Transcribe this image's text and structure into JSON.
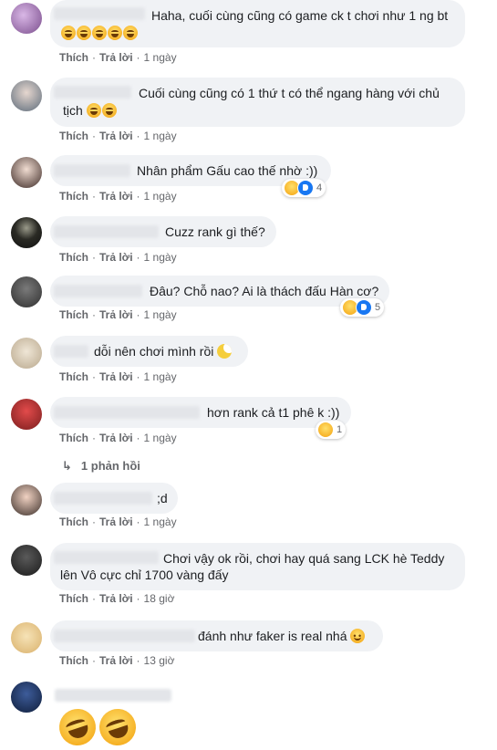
{
  "actions": {
    "like": "Thích",
    "reply": "Trả lời",
    "sep": "·"
  },
  "comments": [
    {
      "text": "Haha, cuối cùng cũng có game ck t chơi như 1 ng bt",
      "time": "1 ngày"
    },
    {
      "text_line1": "Cuối cùng cũng có 1 thứ t có thể ngang hàng với chủ",
      "text_line2": "tịch",
      "time": "1 ngày"
    },
    {
      "text": "Nhân phẩm Gấu cao thế nhờ :))",
      "time": "1 ngày",
      "reaction_count": "4"
    },
    {
      "text": "Cuzz rank gì thế?",
      "time": "1 ngày"
    },
    {
      "text": "Đâu? Chỗ nao? Ai là thách đấu Hàn cơ?",
      "time": "1 ngày",
      "reaction_count": "5"
    },
    {
      "text": "dỗi nên chơi mình rồi",
      "time": "1 ngày"
    },
    {
      "text": "hơn rank cả t1 phê k :))",
      "time": "1 ngày",
      "reaction_count": "1"
    },
    {
      "text": ";d",
      "time": "1 ngày"
    },
    {
      "text_line1": "Chơi vậy ok rồi, chơi hay quá sang LCK hè Teddy",
      "text_line2": "lên Vô cực chỉ 1700 vàng đấy",
      "time": "18 giờ"
    },
    {
      "text": "đánh như faker is real nhá",
      "time": "13 giờ"
    }
  ],
  "replies_link": "1 phản hồi",
  "colors": {
    "bubble": "#f0f2f5",
    "meta": "#65676b",
    "text": "#1c1e21",
    "like_blue": "#1877f2"
  }
}
